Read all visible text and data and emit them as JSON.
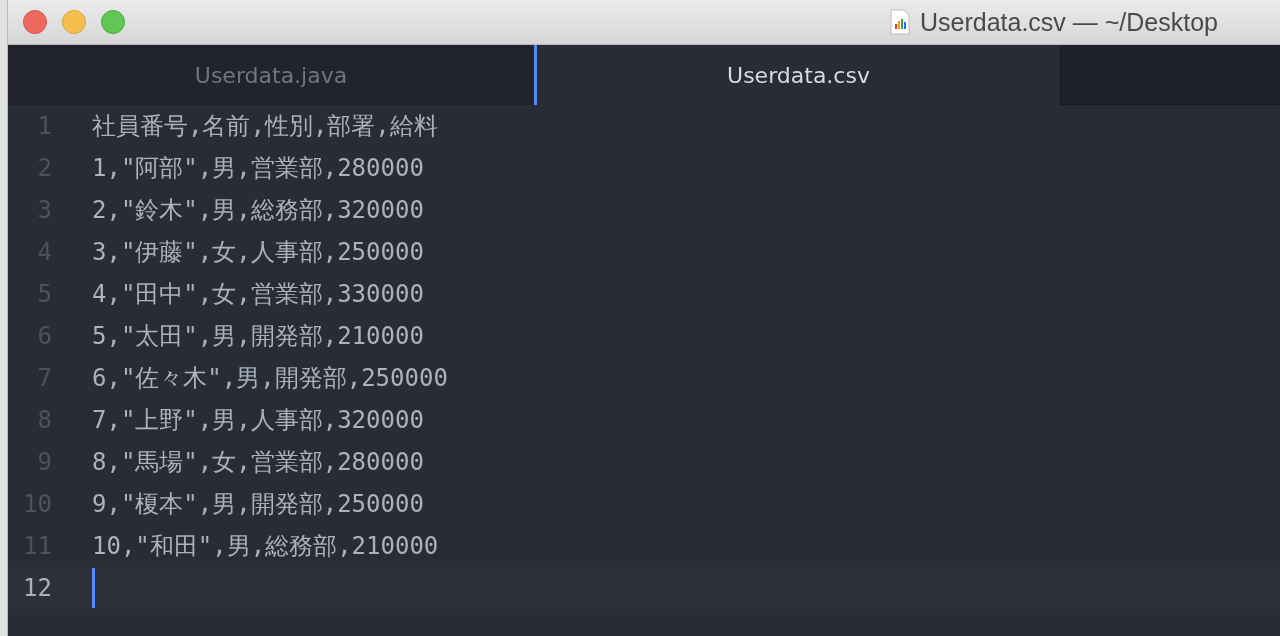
{
  "window": {
    "title": "Userdata.csv — ~/Desktop"
  },
  "tabs": [
    {
      "label": "Userdata.java",
      "selected": false
    },
    {
      "label": "Userdata.csv",
      "selected": true
    }
  ],
  "lines": [
    {
      "number": "1",
      "text": "社員番号,名前,性別,部署,給料",
      "current": false
    },
    {
      "number": "2",
      "text": "1,\"阿部\",男,営業部,280000",
      "current": false
    },
    {
      "number": "3",
      "text": "2,\"鈴木\",男,総務部,320000",
      "current": false
    },
    {
      "number": "4",
      "text": "3,\"伊藤\",女,人事部,250000",
      "current": false
    },
    {
      "number": "5",
      "text": "4,\"田中\",女,営業部,330000",
      "current": false
    },
    {
      "number": "6",
      "text": "5,\"太田\",男,開発部,210000",
      "current": false
    },
    {
      "number": "7",
      "text": "6,\"佐々木\",男,開発部,250000",
      "current": false
    },
    {
      "number": "8",
      "text": "7,\"上野\",男,人事部,320000",
      "current": false
    },
    {
      "number": "9",
      "text": "8,\"馬場\",女,営業部,280000",
      "current": false
    },
    {
      "number": "10",
      "text": "9,\"榎本\",男,開発部,250000",
      "current": false
    },
    {
      "number": "11",
      "text": "10,\"和田\",男,総務部,210000",
      "current": false
    },
    {
      "number": "12",
      "current": true
    }
  ]
}
